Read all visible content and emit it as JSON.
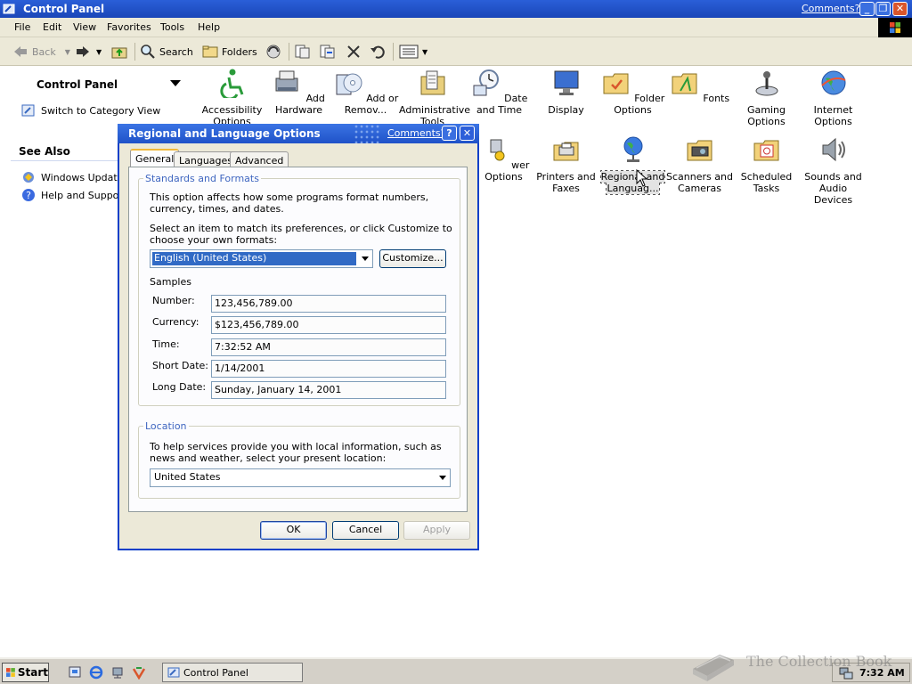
{
  "window": {
    "title": "Control Panel",
    "comments_link": "Comments?",
    "minimize": "_",
    "restore": "❐",
    "close": "✕"
  },
  "menu": [
    "File",
    "Edit",
    "View",
    "Favorites",
    "Tools",
    "Help"
  ],
  "toolbar": {
    "back": "Back",
    "search": "Search",
    "folders": "Folders"
  },
  "left_pane": {
    "title": "Control Panel",
    "switch_link": "Switch to Category View",
    "see_also": "See Also",
    "links": [
      "Windows Update",
      "Help and Support"
    ]
  },
  "items": [
    {
      "label": "Accessibility Options",
      "icon": "accessibility-icon"
    },
    {
      "label": "Add Hardware",
      "icon": "printer-hardware-icon"
    },
    {
      "label": "Add or Remov...",
      "icon": "cd-box-icon"
    },
    {
      "label": "Administrative Tools",
      "icon": "tools-folder-icon"
    },
    {
      "label": "Date and Time",
      "icon": "clock-icon"
    },
    {
      "label": "Display",
      "icon": "monitor-icon"
    },
    {
      "label": "Folder Options",
      "icon": "folder-icon"
    },
    {
      "label": "Fonts",
      "icon": "fonts-folder-icon"
    },
    {
      "label": "Gaming Options",
      "icon": "joystick-icon"
    },
    {
      "label": "Internet Options",
      "icon": "globe-icon"
    },
    {
      "label": "wer Options",
      "icon": "power-icon"
    },
    {
      "label": "Printers and Faxes",
      "icon": "printer-icon"
    },
    {
      "label": "Regional and Languag...",
      "icon": "globe-stand-icon"
    },
    {
      "label": "Scanners and Cameras",
      "icon": "scanner-icon"
    },
    {
      "label": "Scheduled Tasks",
      "icon": "scheduled-tasks-icon"
    },
    {
      "label": "Sounds and Audio Devices",
      "icon": "speaker-icon"
    }
  ],
  "dialog": {
    "title": "Regional and Language Options",
    "comments_link": "Comments?",
    "help": "?",
    "close": "✕",
    "tabs": [
      "General",
      "Languages",
      "Advanced"
    ],
    "standards": {
      "legend": "Standards and Formats",
      "description": "This option affects how some programs format numbers, currency, times, and dates.",
      "instruction": "Select an item to match its preferences, or click Customize to choose your own formats:",
      "selected_format": "English (United States)",
      "customize": "Customize...",
      "samples_title": "Samples",
      "samples": [
        {
          "label": "Number:",
          "value": "123,456,789.00"
        },
        {
          "label": "Currency:",
          "value": "$123,456,789.00"
        },
        {
          "label": "Time:",
          "value": "7:32:52 AM"
        },
        {
          "label": "Short Date:",
          "value": "1/14/2001"
        },
        {
          "label": "Long Date:",
          "value": "Sunday, January 14, 2001"
        }
      ]
    },
    "location": {
      "legend": "Location",
      "description": "To help services provide you with local information, such as news and weather, select your present location:",
      "selected": "United States"
    },
    "buttons": {
      "ok": "OK",
      "cancel": "Cancel",
      "apply": "Apply"
    }
  },
  "taskbar": {
    "start": "Start",
    "task": "Control Panel",
    "clock": "7:32 AM"
  },
  "watermark": "The Collection Book"
}
